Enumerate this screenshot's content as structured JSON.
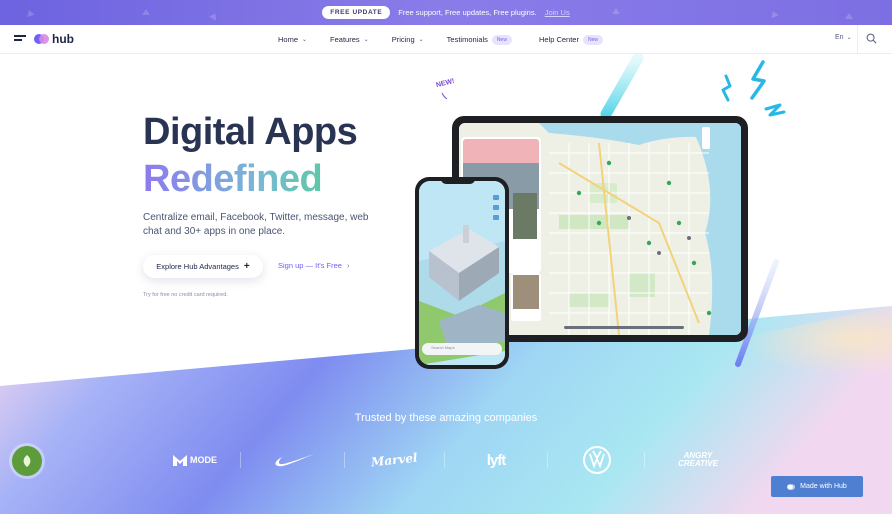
{
  "announcement": {
    "badge": "FREE UPDATE",
    "message": "Free support, Free updates, Free plugins.",
    "link": "Join Us"
  },
  "nav": {
    "logo": "hub",
    "items": [
      {
        "label": "Home",
        "dropdown": true
      },
      {
        "label": "Features",
        "dropdown": true
      },
      {
        "label": "Pricing",
        "dropdown": true
      },
      {
        "label": "Testimonials",
        "badge": "New"
      },
      {
        "label": "Help Center",
        "badge": "New"
      }
    ],
    "language": "En"
  },
  "hero": {
    "title_line1": "Digital Apps",
    "title_line2": "Redefined",
    "subtitle": "Centralize email, Facebook, Twitter, message, web chat and 30+ apps in one place.",
    "primary_button": "Explore Hub Advantages",
    "primary_button_icon": "+",
    "secondary_link": "Sign up — It's Free",
    "secondary_link_icon": "›",
    "note": "Try for free no credit card required.",
    "new_tag": "NEW!"
  },
  "devices": {
    "phone_search_placeholder": "Search Maps"
  },
  "trusted": {
    "heading": "Trusted by these amazing companies",
    "logos": [
      {
        "name": "MODE",
        "icon": "mode-m-icon"
      },
      {
        "name": "Nike",
        "icon": "nike-swoosh-icon"
      },
      {
        "name": "Marvel"
      },
      {
        "name": "lyft"
      },
      {
        "name": "VW",
        "icon": "vw-logo-icon"
      },
      {
        "name": "ANGRY CREATIVE"
      }
    ]
  },
  "footer_button": "Made with Hub",
  "colors": {
    "accent": "#6e61f5",
    "title": "#293352",
    "announcement_bg": "#7a6fe4",
    "made_with_hub_bg": "#4f7fd0",
    "chat_bubble": "#5d9c3a"
  }
}
